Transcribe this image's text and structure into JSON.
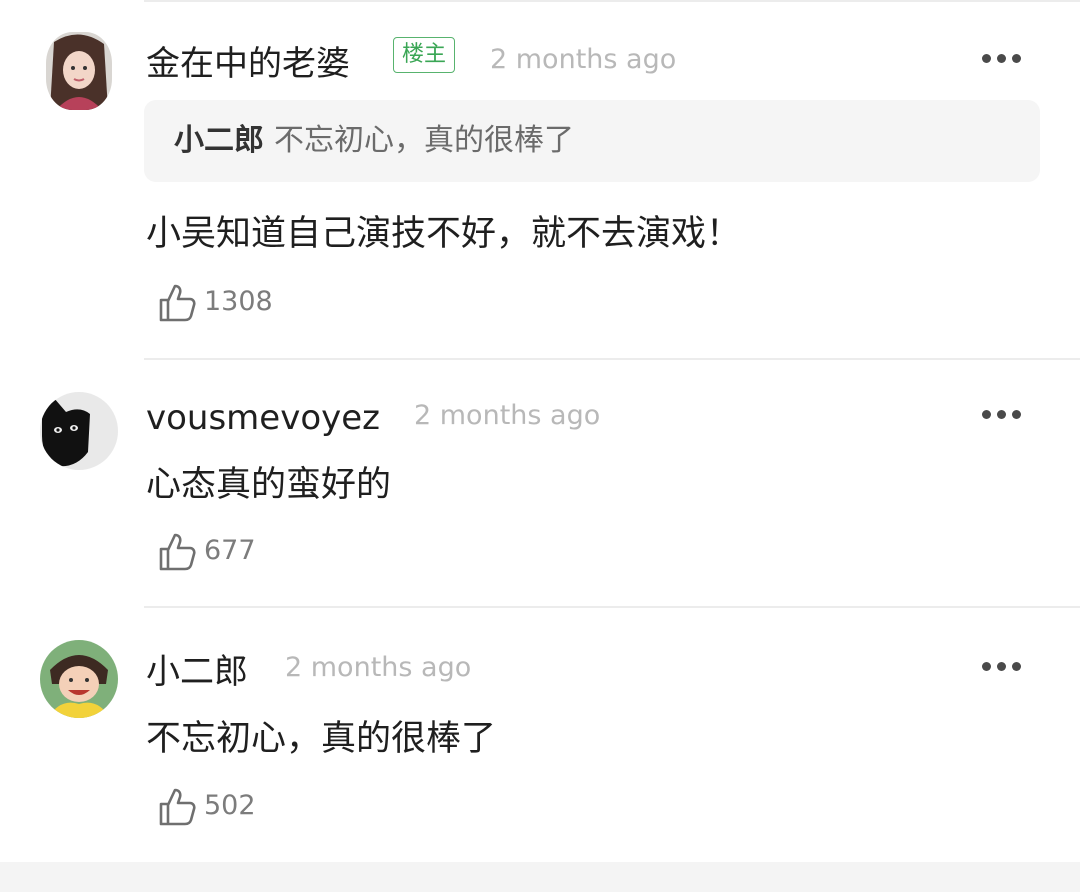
{
  "comments": [
    {
      "author": "金在中的老婆",
      "badge": "楼主",
      "time": "2 months ago",
      "quote": {
        "author": "小二郎",
        "text": "不忘初心，真的很棒了"
      },
      "text": "小吴知道自己演技不好，就不去演戏！",
      "likes": "1308",
      "avatar_icon": "avatar-woman-icon"
    },
    {
      "author": "vousmevoyez",
      "time": "2 months ago",
      "text": "心态真的蛮好的",
      "likes": "677",
      "avatar_icon": "avatar-black-cat-icon"
    },
    {
      "author": "小二郎",
      "time": "2 months ago",
      "text": "不忘初心，真的很棒了",
      "likes": "502",
      "avatar_icon": "avatar-smiling-girl-icon"
    }
  ],
  "colors": {
    "badge": "#3aa655",
    "timestamp": "#b8b8b8",
    "quote_bg": "#f5f5f5",
    "divider": "#ececec"
  },
  "icons": {
    "more": "more-dots-icon",
    "like": "thumbs-up-icon"
  }
}
